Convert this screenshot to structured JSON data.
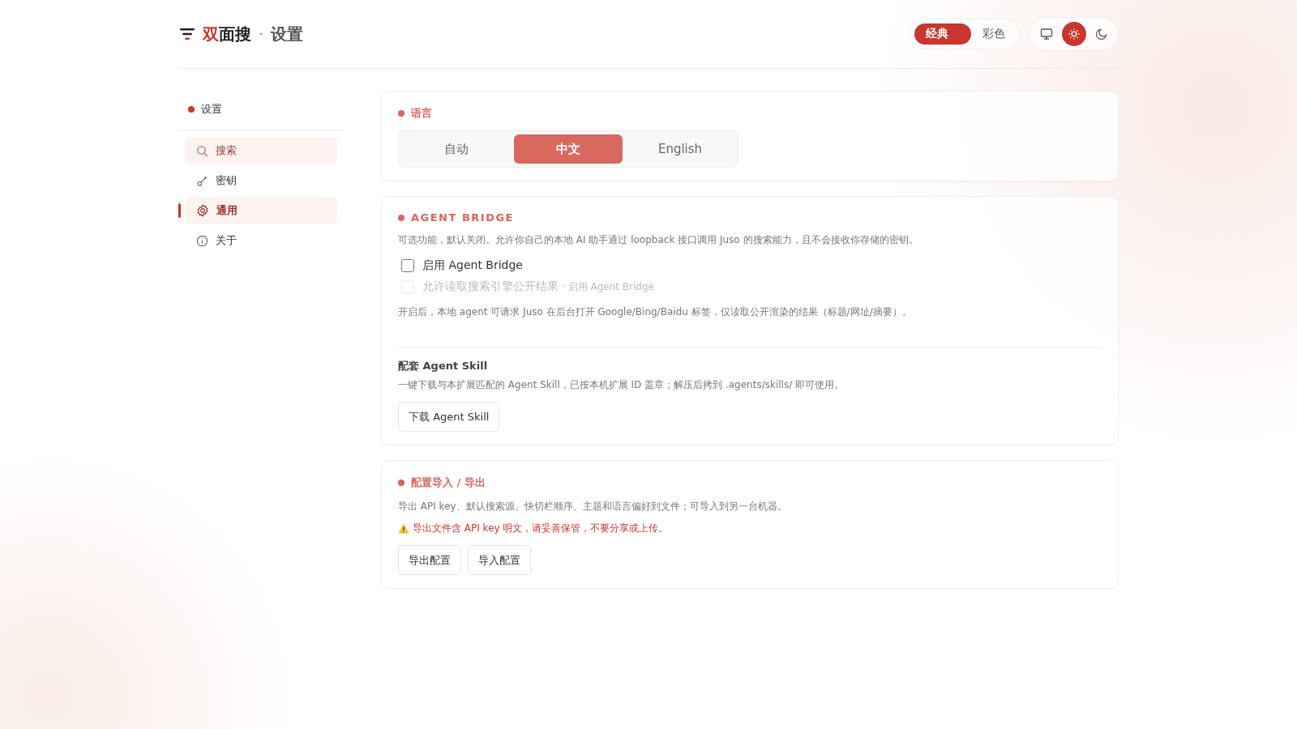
{
  "header": {
    "logo": {
      "accent": "双",
      "rest": "面搜"
    },
    "separator": "·",
    "title": "设置",
    "style_toggle": [
      {
        "label": "经典",
        "selected": true
      },
      {
        "label": "彩色",
        "selected": false
      }
    ],
    "theme_buttons": [
      {
        "kind": "system",
        "selected": false
      },
      {
        "kind": "light",
        "selected": true
      },
      {
        "kind": "dark",
        "selected": false
      }
    ]
  },
  "sidebar": {
    "heading": "设置",
    "items": [
      {
        "label": "搜索",
        "kind": "search",
        "selected": false,
        "hovered": true
      },
      {
        "label": "密钥",
        "kind": "key",
        "selected": false,
        "hovered": false
      },
      {
        "label": "通用",
        "kind": "gear",
        "selected": true,
        "hovered": false
      },
      {
        "label": "关于",
        "kind": "info",
        "selected": false,
        "hovered": false
      }
    ]
  },
  "language": {
    "title": "语言",
    "options": [
      {
        "label": "自动",
        "selected": false
      },
      {
        "label": "中文",
        "selected": true
      },
      {
        "label": "English",
        "selected": false
      }
    ]
  },
  "agent_bridge": {
    "title": "AGENT BRIDGE",
    "description": "可选功能，默认关闭。允许你自己的本地 AI 助手通过 loopback 接口调用 Juso 的搜索能力，且不会接收你存储的密钥。",
    "options": [
      {
        "label": "启用 Agent Bridge",
        "checked": false,
        "disabled": false
      },
      {
        "label": "允许读取搜索引擎公开结果",
        "hint": "· 启用 Agent Bridge",
        "checked": false,
        "disabled": true
      }
    ],
    "note": "开启后，本地 agent 可请求 Juso 在后台打开 Google/Bing/Baidu 标签，仅读取公开渲染的结果（标题/网址/摘要）。",
    "skill_title": "配套 Agent Skill",
    "skill_description": "一键下载与本扩展匹配的 Agent Skill，已按本机扩展 ID 盖章；解压后拷到 .agents/skills/ 即可使用。",
    "skill_button": "下载 Agent Skill"
  },
  "config": {
    "title": "配置导入 / 导出",
    "description": "导出 API key、默认搜索源、快切栏顺序、主题和语言偏好到文件；可导入到另一台机器。",
    "warning": "导出文件含 API key 明文，请妥善保管，不要分享或上传。",
    "buttons": [
      "导出配置",
      "导入配置"
    ]
  }
}
